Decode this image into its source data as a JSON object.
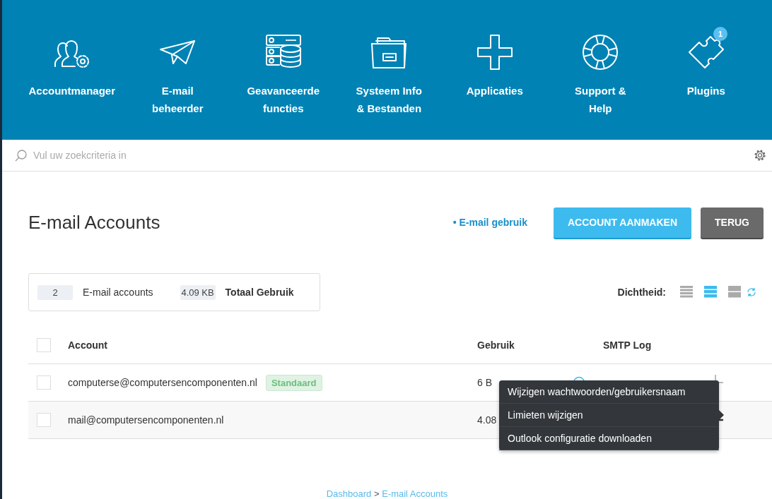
{
  "nav": [
    {
      "lines": [
        "Accountmanager"
      ]
    },
    {
      "lines": [
        "E-mail",
        "beheerder"
      ]
    },
    {
      "lines": [
        "Geavanceerde",
        "functies"
      ]
    },
    {
      "lines": [
        "Systeem Info",
        "& Bestanden"
      ]
    },
    {
      "lines": [
        "Applicaties"
      ]
    },
    {
      "lines": [
        "Support &",
        "Help"
      ]
    },
    {
      "lines": [
        "Plugins"
      ],
      "badge": "1"
    }
  ],
  "search": {
    "placeholder": "Vul uw zoekcriteria in"
  },
  "page": {
    "title": "E-mail Accounts",
    "usage_link": "• E-mail gebruik",
    "buttons": [
      {
        "label": "ACCOUNT AANMAKEN",
        "kind": "primary"
      },
      {
        "label": "TERUG",
        "kind": "secondary"
      }
    ]
  },
  "summary": [
    {
      "value": "2",
      "label": "E-mail accounts"
    },
    {
      "value": "4.09 KB",
      "label": "Totaal Gebruik"
    }
  ],
  "density": {
    "label": "Dichtheid:",
    "options": [
      {
        "selected": false
      },
      {
        "selected": true
      },
      {
        "selected": false
      }
    ]
  },
  "table": {
    "all_checked": false,
    "columns": [
      "Account",
      "Gebruik",
      "SMTP Log"
    ],
    "rows": [
      {
        "account": "computerse@computersencomponenten.nl",
        "tag": "Standaard",
        "usage": "6 B",
        "checked": false,
        "expanded": false,
        "help": true
      },
      {
        "account": "mail@computersencomponenten.nl",
        "usage": "4.08",
        "checked": false,
        "expanded": true,
        "help": false
      }
    ]
  },
  "menu": {
    "items": [
      "Wijzigen wachtwoorden/gebruikersnaam",
      "Limieten wijzigen",
      "Outlook configuratie downloaden"
    ]
  },
  "breadcrumb": [
    "Dashboard",
    ">",
    "E-mail Accounts"
  ]
}
